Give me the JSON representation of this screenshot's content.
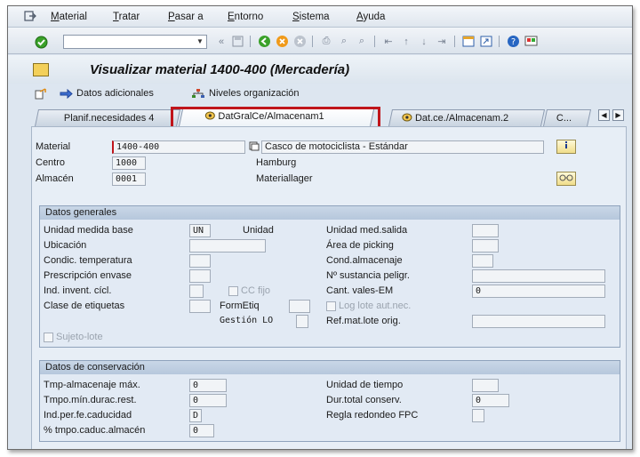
{
  "menu": {
    "items": [
      {
        "label": "Material",
        "u": "M"
      },
      {
        "label": "Tratar",
        "u": "T"
      },
      {
        "label": "Pasar a",
        "u": "P"
      },
      {
        "label": "Entorno",
        "u": "E"
      },
      {
        "label": "Sistema",
        "u": "S"
      },
      {
        "label": "Ayuda",
        "u": "A"
      }
    ]
  },
  "toolbar": {
    "command_value": ""
  },
  "title": "Visualizar material 1400-400 (Mercadería)",
  "app_toolbar": {
    "additional_data": "Datos adicionales",
    "org_levels": "Niveles organización"
  },
  "tabs": [
    {
      "label": "Planif.necesidades 4"
    },
    {
      "label": "DatGralCe/Almacenam1"
    },
    {
      "label": "Dat.ce./Almacenam.2"
    },
    {
      "label": "C..."
    }
  ],
  "header": {
    "material_label": "Material",
    "material_value": "1400-400",
    "material_desc": "Casco de motociclista - Estándar",
    "center_label": "Centro",
    "center_value": "1000",
    "center_desc": "Hamburg",
    "store_label": "Almacén",
    "store_value": "0001",
    "store_desc": "Materiallager"
  },
  "general": {
    "title": "Datos generales",
    "base_unit_label": "Unidad medida base",
    "base_unit_value": "UN",
    "base_unit_desc": "Unidad",
    "issue_unit_label": "Unidad med.salida",
    "location_label": "Ubicación",
    "picking_label": "Área de picking",
    "temp_label": "Condic. temperatura",
    "storage_cond_label": "Cond.almacenaje",
    "container_label": "Prescripción envase",
    "hazard_label": "Nº sustancia peligr.",
    "cycle_label": "Ind. invent. cícl.",
    "cc_fixed_label": "CC fijo",
    "gr_slips_label": "Cant. vales-EM",
    "gr_slips_value": "0",
    "label_type_label": "Clase de etiquetas",
    "label_form_label": "FormEtiq",
    "batch_auto_label": "Log lote aut.nec.",
    "lo_mgmt_label": "Gestión LO",
    "batch_ref_label": "Ref.mat.lote orig.",
    "batch_subject_label": "Sujeto-lote"
  },
  "conservation": {
    "title": "Datos de conservación",
    "max_storage_label": "Tmp-almacenaje máx.",
    "max_storage_value": "0",
    "time_unit_label": "Unidad de tiempo",
    "min_rem_label": "Tmpo.mín.durac.rest.",
    "min_rem_value": "0",
    "total_shelf_label": "Dur.total conserv.",
    "total_shelf_value": "0",
    "period_ind_label": "Ind.per.fe.caducidad",
    "period_ind_value": "D",
    "rounding_label": "Regla redondeo FPC",
    "pct_label": "% tmpo.caduc.almacén",
    "pct_value": "0"
  },
  "colors": {
    "highlight": "#c0151b",
    "background": "#dde6f0",
    "group_header": "#c3d2e4"
  }
}
